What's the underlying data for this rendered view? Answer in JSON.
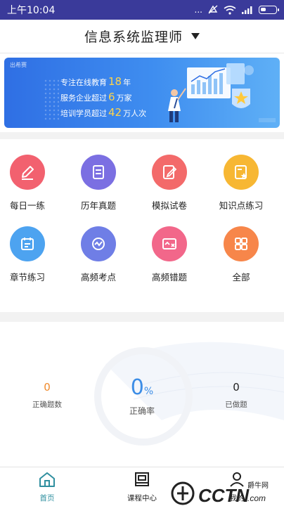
{
  "status_bar": {
    "time": "上午10:04",
    "dots": "..."
  },
  "header": {
    "title": "信息系统监理师"
  },
  "banner": {
    "logo_text": "出希赛",
    "line1_prefix": "专注在线教育",
    "line1_num": "18",
    "line1_suffix": "年",
    "line2_prefix": "服务企业超过",
    "line2_num": "6",
    "line2_suffix": "万家",
    "line3_prefix": "培训学员超过",
    "line3_num": "42",
    "line3_suffix": "万人次"
  },
  "menu": [
    {
      "label": "每日一练",
      "color": "#f2616f",
      "icon": "pencil-icon"
    },
    {
      "label": "历年真题",
      "color": "#7b6fe2",
      "icon": "document-icon"
    },
    {
      "label": "模拟试卷",
      "color": "#f36a6a",
      "icon": "exam-paper-icon"
    },
    {
      "label": "知识点练习",
      "color": "#f7b733",
      "icon": "knowledge-icon"
    },
    {
      "label": "章节练习",
      "color": "#4da3f0",
      "icon": "chapter-icon"
    },
    {
      "label": "高频考点",
      "color": "#6f7ee6",
      "icon": "hot-point-icon"
    },
    {
      "label": "高频错题",
      "color": "#f2678a",
      "icon": "wrong-question-icon"
    },
    {
      "label": "全部",
      "color": "#f7864a",
      "icon": "grid-icon"
    }
  ],
  "stats": {
    "correct_count": "0",
    "correct_count_label": "正确题数",
    "accuracy_value": "0",
    "accuracy_unit": "%",
    "accuracy_label": "正确率",
    "done_count": "0",
    "done_count_label": "已做题"
  },
  "tabs": [
    {
      "label": "首页",
      "icon": "home-icon",
      "active": true
    },
    {
      "label": "课程中心",
      "icon": "course-icon",
      "active": false
    },
    {
      "label": "我的",
      "icon": "user-icon",
      "active": false
    }
  ],
  "watermark": {
    "text1": "CCTN",
    "text2": ".com",
    "text3": "爵牛网"
  },
  "colors": {
    "status_bar": "#3a3a9a",
    "accent": "#3c8de6",
    "orange": "#f08a2c",
    "tab_active": "#2f8f9f"
  }
}
